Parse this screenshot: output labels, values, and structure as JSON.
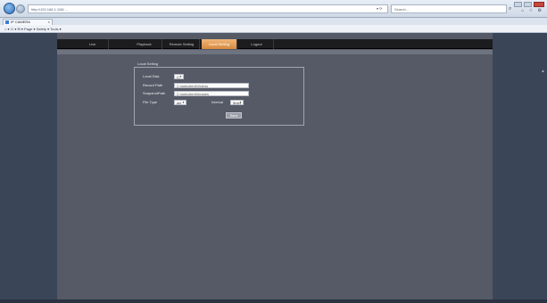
{
  "browser": {
    "address": "http://192.168.1.108/ ... ",
    "search_placeholder": "Search...",
    "tab_title": "IP CAMERA",
    "tab_close": "×",
    "command_bar": "Page ▾  Safety ▾  Tools ▾",
    "right_icons": "⌂ ☆ ⚙"
  },
  "nav": {
    "items": [
      {
        "label": "Live"
      },
      {
        "label": "Playback"
      },
      {
        "label": "Remote Setting"
      },
      {
        "label": "Local Setting"
      },
      {
        "label": "Logout"
      }
    ],
    "active_index": 3
  },
  "local_setting": {
    "title": "Local Setting",
    "local_disk_label": "Local Disk",
    "local_disk_value": "C:",
    "record_path_label": "Record Path",
    "record_path_value": "C:\\webclient\\Videos",
    "snapshot_path_label": "SnapshotPath",
    "snapshot_path_value": "C:\\webclient\\Images",
    "file_type_label": "File Type",
    "file_type_value": "avi",
    "interval_label": "Interval",
    "interval_value": "5min",
    "save_label": "Save"
  },
  "colors": {
    "active_tab": "#d78a3e",
    "nav_bg": "#1c1c1e",
    "content_bg": "#555a66",
    "page_bg": "#3a4558"
  }
}
